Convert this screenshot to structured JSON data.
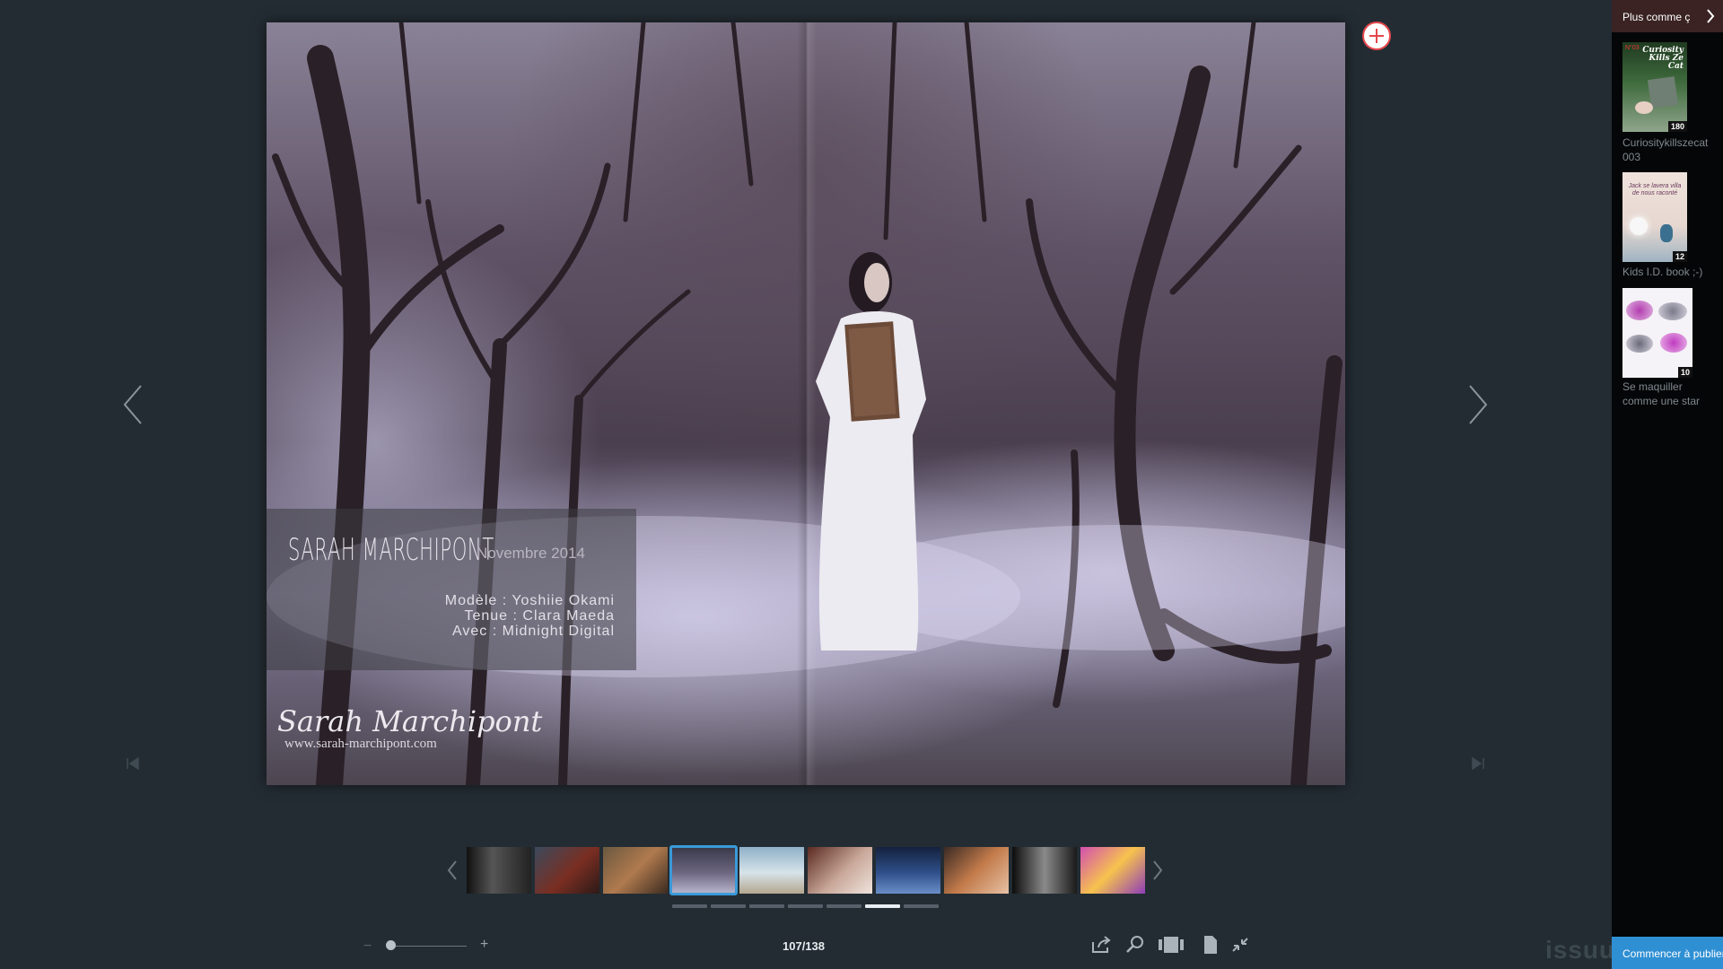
{
  "spread": {
    "caption": {
      "name": "SARAH MARCHIPONT",
      "date": "Novembre 2014",
      "credits": [
        "Modèle : Yoshiie Okami",
        "Tenue : Clara Maeda",
        "Avec : Midnight Digital"
      ]
    },
    "signature": "Sarah Marchipont",
    "website": "www.sarah-marchipont.com"
  },
  "toolbar": {
    "page_counter": "107/138",
    "zoom_minus": "−",
    "zoom_plus": "+",
    "zoom_level": 0.0
  },
  "thumbnails": {
    "count": 10,
    "active_index": 3,
    "pager_pages": 7,
    "pager_active": 5
  },
  "sidebar": {
    "header_label": "Plus comme ç",
    "items": [
      {
        "title": "Curiositykillszecat 003",
        "count": "180",
        "cover_text": "Curiosity Kills Ze Cat",
        "issue": "N°03"
      },
      {
        "title": "Kids I.D. book ;-)",
        "count": "12",
        "cover_text": "Jack se lavera villa de nous raconté"
      },
      {
        "title": "Se maquiller comme une star",
        "count": "10"
      }
    ],
    "cta_label": "Commencer à publier"
  },
  "brand": {
    "logo": "issuu"
  },
  "colors": {
    "accent": "#2f8fd3",
    "add": "#e5484d",
    "background": "#232c33"
  }
}
